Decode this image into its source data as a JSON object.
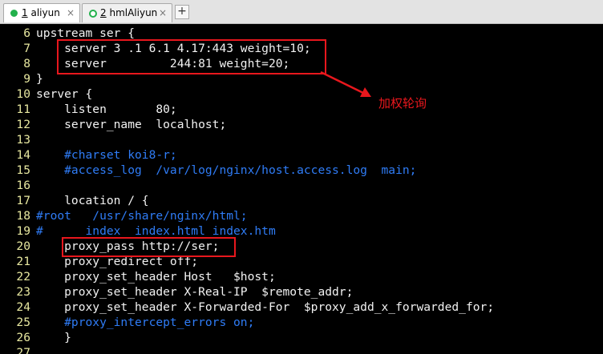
{
  "tabs": [
    {
      "num": "1",
      "label": "aliyun",
      "close": "×",
      "active": true
    },
    {
      "num": "2",
      "label": "hmlAliyun",
      "close": "×",
      "active": false
    }
  ],
  "add_tab": "+",
  "lines": [
    {
      "n": "6",
      "text": "upstream ser {",
      "style": "w"
    },
    {
      "n": "7",
      "text": "    server 3 .1 6.1 4.17:443 weight=10;",
      "style": "w"
    },
    {
      "n": "8",
      "text": "    server         244:81 weight=20;",
      "style": "w"
    },
    {
      "n": "9",
      "text": "}",
      "style": "w"
    },
    {
      "n": "10",
      "text": "server {",
      "style": "w"
    },
    {
      "n": "11",
      "text": "    listen       80;",
      "style": "w"
    },
    {
      "n": "12",
      "text": "    server_name  localhost;",
      "style": "w"
    },
    {
      "n": "13",
      "text": "",
      "style": "w"
    },
    {
      "n": "14",
      "text": "    #charset koi8-r;",
      "style": "c"
    },
    {
      "n": "15",
      "text": "    #access_log  /var/log/nginx/host.access.log  main;",
      "style": "c"
    },
    {
      "n": "16",
      "text": "",
      "style": "w"
    },
    {
      "n": "17",
      "text": "    location / {",
      "style": "w"
    },
    {
      "n": "18",
      "text": "#root   /usr/share/nginx/html;",
      "style": "c"
    },
    {
      "n": "19",
      "text": "#      index  index.html index.htm",
      "style": "c"
    },
    {
      "n": "20",
      "text": "    proxy_pass http://ser;",
      "style": "w"
    },
    {
      "n": "21",
      "text": "    proxy_redirect off;",
      "style": "w"
    },
    {
      "n": "22",
      "text": "    proxy_set_header Host   $host;",
      "style": "w"
    },
    {
      "n": "23",
      "text": "    proxy_set_header X-Real-IP  $remote_addr;",
      "style": "w"
    },
    {
      "n": "24",
      "text": "    proxy_set_header X-Forwarded-For  $proxy_add_x_forwarded_for;",
      "style": "w"
    },
    {
      "n": "25",
      "text": "    #proxy_intercept_errors on;",
      "style": "c"
    },
    {
      "n": "26",
      "text": "    }",
      "style": "w"
    },
    {
      "n": "27",
      "text": "",
      "style": "w"
    }
  ],
  "annotation": "加权轮询",
  "colors": {
    "background": "#000000",
    "code": "#f2f2f2",
    "comment": "#2f7cf6",
    "line_number": "#e8e8a0",
    "highlight": "#e8171d",
    "tab_dot": "#22b14c"
  }
}
